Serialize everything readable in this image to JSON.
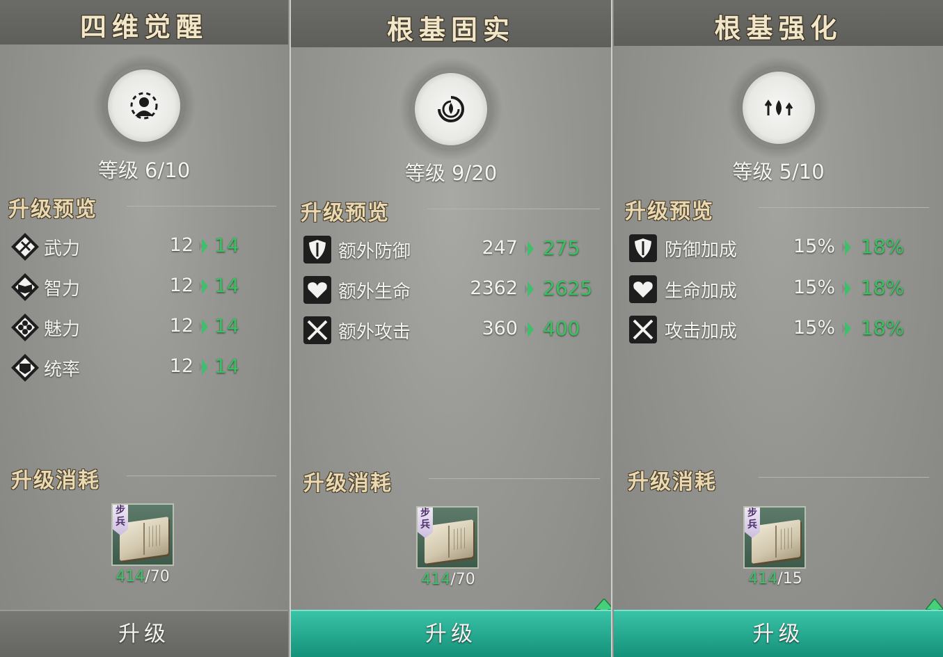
{
  "panels": [
    {
      "title": "四维觉醒",
      "emblem_icon": "awaken-figure-icon",
      "level": "等级 6/10",
      "preview_title": "升级预览",
      "stats": [
        {
          "icon": "weapon-icon",
          "name": "武力",
          "old": "12",
          "new": "14"
        },
        {
          "icon": "book-icon",
          "name": "智力",
          "old": "12",
          "new": "14"
        },
        {
          "icon": "flower-icon",
          "name": "魅力",
          "old": "12",
          "new": "14"
        },
        {
          "icon": "command-icon",
          "name": "统率",
          "old": "12",
          "new": "14"
        }
      ],
      "cost_title": "升级消耗",
      "item": {
        "tag_top": "步",
        "tag_bottom": "兵",
        "icon": "manual-book-icon",
        "have": "414",
        "need": "/70"
      },
      "button": {
        "label": "升级",
        "enabled": false
      }
    },
    {
      "title": "根基固实",
      "emblem_icon": "swirl-drop-icon",
      "level": "等级 9/20",
      "preview_title": "升级预览",
      "stats": [
        {
          "icon": "shield-icon",
          "name": "额外防御",
          "old": "247",
          "new": "275"
        },
        {
          "icon": "heart-icon",
          "name": "额外生命",
          "old": "2362",
          "new": "2625"
        },
        {
          "icon": "crossed-swords-icon",
          "name": "额外攻击",
          "old": "360",
          "new": "400"
        }
      ],
      "cost_title": "升级消耗",
      "item": {
        "tag_top": "步",
        "tag_bottom": "兵",
        "icon": "manual-book-icon",
        "have": "414",
        "need": "/70"
      },
      "button": {
        "label": "升级",
        "enabled": true
      }
    },
    {
      "title": "根基强化",
      "emblem_icon": "drop-up-arrows-icon",
      "level": "等级 5/10",
      "preview_title": "升级预览",
      "stats": [
        {
          "icon": "shield-icon",
          "name": "防御加成",
          "old": "15%",
          "new": "18%"
        },
        {
          "icon": "heart-icon",
          "name": "生命加成",
          "old": "15%",
          "new": "18%"
        },
        {
          "icon": "crossed-swords-icon",
          "name": "攻击加成",
          "old": "15%",
          "new": "18%"
        }
      ],
      "cost_title": "升级消耗",
      "item": {
        "tag_top": "步",
        "tag_bottom": "兵",
        "icon": "manual-book-icon",
        "have": "414",
        "need": "/15"
      },
      "button": {
        "label": "升级",
        "enabled": true
      }
    }
  ],
  "colors": {
    "increase": "#39c061",
    "button_active": "#1fa88c",
    "button_disabled": "#6f6f6c",
    "title_gold": "#f1e6c8"
  }
}
